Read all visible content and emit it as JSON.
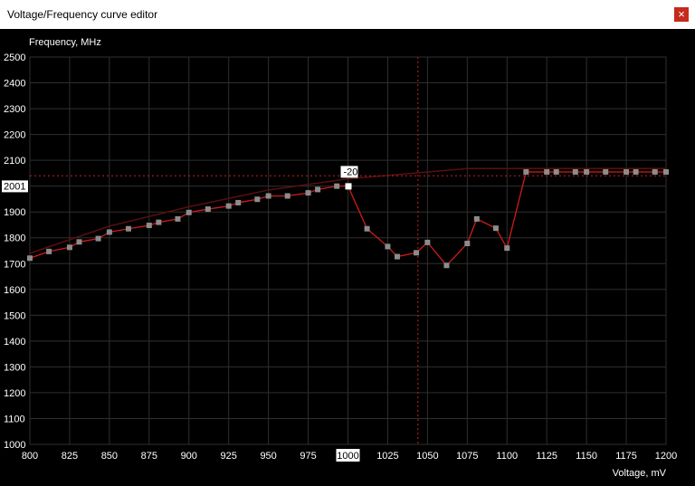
{
  "window": {
    "title": "Voltage/Frequency curve editor",
    "close_glyph": "×",
    "close_icon": "close-icon"
  },
  "colors": {
    "background": "#000000",
    "grid": "#2f2f2f",
    "curve": "#d11b1b",
    "point": "#8c8c8c",
    "selected_point": "#ffffff",
    "offset_band": "#5a0f0f",
    "crosshair": "#c72020",
    "text": "#ffffff"
  },
  "chart_data": {
    "type": "line",
    "xlabel": "Voltage, mV",
    "ylabel": "Frequency, MHz",
    "xlim": [
      800,
      1200
    ],
    "ylim": [
      1000,
      2500
    ],
    "x_ticks": [
      "800",
      "825",
      "850",
      "875",
      "900",
      "925",
      "950",
      "975",
      "1000",
      "1025",
      "1050",
      "1075",
      "1100",
      "1125",
      "1150",
      "1175",
      "1200"
    ],
    "y_ticks": [
      "1000",
      "1100",
      "1200",
      "1300",
      "1400",
      "1500",
      "1600",
      "1700",
      "1800",
      "1900",
      "2000",
      "2100",
      "2200",
      "2300",
      "2400",
      "2500"
    ],
    "grid": true,
    "series": [
      {
        "values_mv": [
          800,
          812,
          825,
          831,
          843,
          850,
          862,
          875,
          881,
          893,
          900,
          912,
          925,
          931,
          943,
          950,
          962,
          975,
          981,
          993
        ],
        "values_mhz": [
          1721,
          1747,
          1763,
          1784,
          1797,
          1822,
          1835,
          1848,
          1860,
          1873,
          1898,
          1911,
          1923,
          1936,
          1949,
          1962,
          1962,
          1974,
          1987,
          2000
        ]
      }
    ],
    "curve": [
      [
        800,
        1721
      ],
      [
        812,
        1747
      ],
      [
        825,
        1763
      ],
      [
        831,
        1784
      ],
      [
        843,
        1797
      ],
      [
        850,
        1822
      ],
      [
        862,
        1835
      ],
      [
        875,
        1848
      ],
      [
        881,
        1860
      ],
      [
        893,
        1873
      ],
      [
        900,
        1898
      ],
      [
        912,
        1911
      ],
      [
        925,
        1923
      ],
      [
        931,
        1936
      ],
      [
        943,
        1949
      ],
      [
        950,
        1962
      ],
      [
        962,
        1962
      ],
      [
        975,
        1974
      ],
      [
        981,
        1987
      ],
      [
        993,
        2000
      ],
      [
        1000,
        2001
      ],
      [
        1012,
        1835
      ],
      [
        1025,
        1766
      ],
      [
        1031,
        1727
      ],
      [
        1043,
        1742
      ],
      [
        1050,
        1782
      ],
      [
        1062,
        1693
      ],
      [
        1075,
        1778
      ],
      [
        1081,
        1873
      ],
      [
        1093,
        1837
      ],
      [
        1100,
        1760
      ],
      [
        1112,
        2055
      ],
      [
        1125,
        2055
      ],
      [
        1131,
        2055
      ],
      [
        1143,
        2055
      ],
      [
        1150,
        2055
      ],
      [
        1162,
        2055
      ],
      [
        1175,
        2055
      ],
      [
        1181,
        2055
      ],
      [
        1193,
        2055
      ],
      [
        1200,
        2055
      ]
    ],
    "offset_band": [
      [
        800,
        1740
      ],
      [
        850,
        1845
      ],
      [
        900,
        1920
      ],
      [
        950,
        1985
      ],
      [
        1000,
        2028
      ],
      [
        1050,
        2055
      ],
      [
        1075,
        2068
      ],
      [
        1100,
        2068
      ],
      [
        1150,
        2068
      ],
      [
        1200,
        2068
      ]
    ],
    "points_mv": [
      800,
      812,
      825,
      831,
      843,
      850,
      862,
      875,
      881,
      893,
      900,
      912,
      925,
      931,
      943,
      950,
      962,
      975,
      981,
      993,
      1000,
      1012,
      1025,
      1031,
      1043,
      1050,
      1062,
      1075,
      1081,
      1093,
      1100,
      1112,
      1125,
      1131,
      1143,
      1150,
      1162,
      1175,
      1181,
      1193,
      1200
    ],
    "selected": {
      "voltage_mv": 1000,
      "frequency_mhz": 2001,
      "offset_label": "-20",
      "freq_label": "2001",
      "volt_label": "1000"
    },
    "crosshair": {
      "voltage_mv": 1044,
      "frequency_mhz": 2040
    }
  }
}
